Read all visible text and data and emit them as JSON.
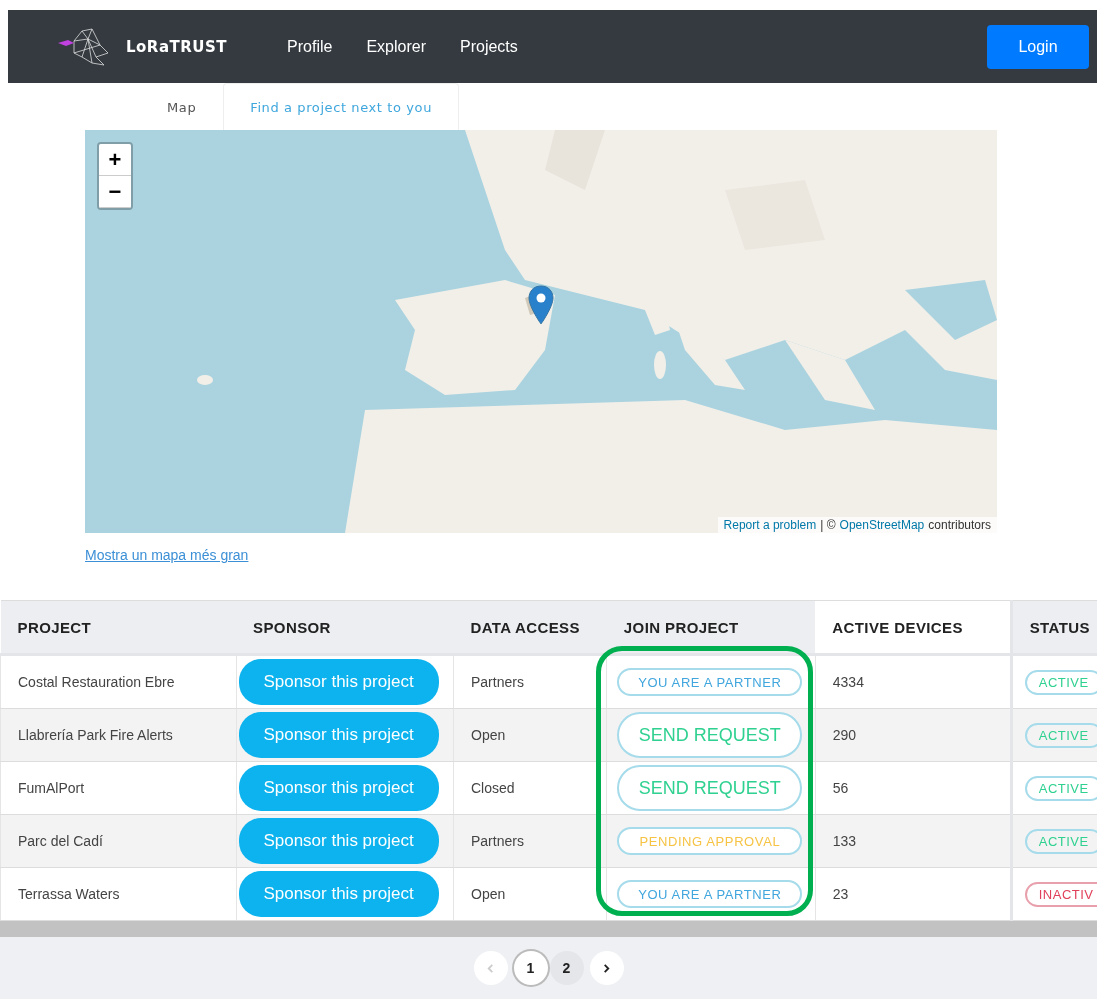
{
  "navbar": {
    "brand": "LoRaTRUST",
    "links": [
      "Profile",
      "Explorer",
      "Projects"
    ],
    "login": "Login"
  },
  "tabs": [
    {
      "label": "Map",
      "selected": false
    },
    {
      "label": "Find a project next to you",
      "selected": true
    }
  ],
  "map": {
    "zoom_in": "+",
    "zoom_out": "−",
    "report": "Report a problem",
    "separator": "| ©",
    "osm": "OpenStreetMap",
    "contributors": "contributors",
    "larger_map_link": "Mostra un mapa més gran"
  },
  "table": {
    "columns": [
      "PROJECT",
      "SPONSOR",
      "DATA ACCESS",
      "JOIN PROJECT",
      "ACTIVE DEVICES",
      "STATUS"
    ],
    "rows": [
      {
        "project": "Costal Restauration Ebre",
        "sponsor": "Sponsor this project",
        "access": "Partners",
        "join": {
          "kind": "partner",
          "label": "YOU ARE A PARTNER"
        },
        "devices": "4334",
        "status": {
          "kind": "active",
          "label": "ACTIVE"
        }
      },
      {
        "project": "Llabrería Park Fire Alerts",
        "sponsor": "Sponsor this project",
        "access": "Open",
        "join": {
          "kind": "request",
          "label": "SEND REQUEST"
        },
        "devices": "290",
        "status": {
          "kind": "active",
          "label": "ACTIVE"
        }
      },
      {
        "project": "FumAlPort",
        "sponsor": "Sponsor this project",
        "access": "Closed",
        "join": {
          "kind": "request",
          "label": "SEND REQUEST"
        },
        "devices": "56",
        "status": {
          "kind": "active",
          "label": "ACTIVE"
        }
      },
      {
        "project": "Parc del Cadí",
        "sponsor": "Sponsor this project",
        "access": "Partners",
        "join": {
          "kind": "pending",
          "label": "PENDING APPROVAL"
        },
        "devices": "133",
        "status": {
          "kind": "active",
          "label": "ACTIVE"
        }
      },
      {
        "project": "Terrassa Waters",
        "sponsor": "Sponsor this project",
        "access": "Open",
        "join": {
          "kind": "partner",
          "label": "YOU ARE A PARTNER"
        },
        "devices": "23",
        "status": {
          "kind": "inactive",
          "label": "INACTIV"
        }
      }
    ]
  },
  "pagination": {
    "previous_disabled": true,
    "pages": [
      {
        "label": "1",
        "selected": true
      },
      {
        "label": "2",
        "selected": false
      }
    ]
  }
}
